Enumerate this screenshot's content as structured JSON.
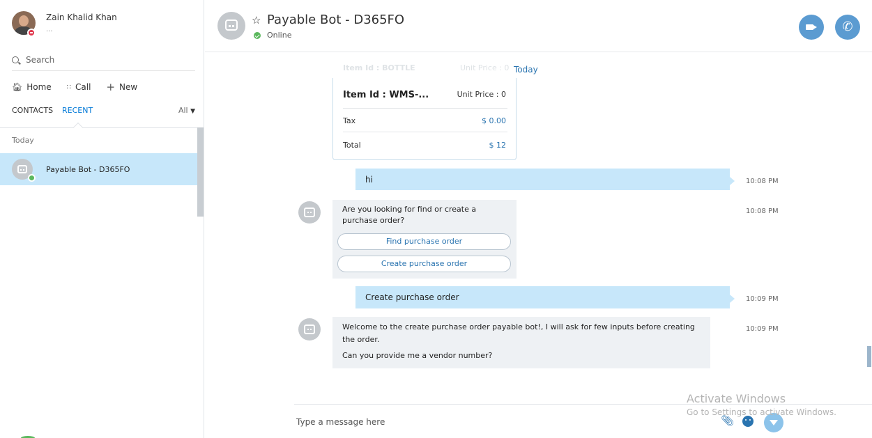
{
  "profile": {
    "name": "Zain Khalid Khan",
    "mood": "..."
  },
  "search": {
    "placeholder": "Search"
  },
  "nav": {
    "home": "Home",
    "call": "Call",
    "new": "New"
  },
  "tabs": {
    "contacts": "CONTACTS",
    "recent": "RECENT",
    "filter": "All"
  },
  "recent": {
    "group": "Today",
    "contact_name": "Payable Bot - D365FO"
  },
  "header": {
    "title": "Payable Bot - D365FO",
    "status": "Online"
  },
  "chat": {
    "faded_item": "Item Id : BOTTLE",
    "faded_price": "Unit Price : 0",
    "date_label": "Today",
    "receipt": {
      "item": "Item Id : WMS-...",
      "unit_price": "Unit Price : 0",
      "tax_label": "Tax",
      "tax_value": "$ 0.00",
      "total_label": "Total",
      "total_value": "$ 12"
    },
    "messages": [
      {
        "from": "me",
        "text": "hi",
        "time": "10:08 PM"
      },
      {
        "from": "bot",
        "text": "Are you looking for find or create a purchase order?",
        "time": "10:08 PM",
        "actions": [
          "Find purchase order",
          "Create purchase order"
        ]
      },
      {
        "from": "me",
        "text": "Create purchase order",
        "time": "10:09 PM"
      },
      {
        "from": "bot",
        "text": "Welcome to the create purchase order payable bot!, I will ask for few inputs before creating the order.",
        "text2": "Can you provide me a vendor number?",
        "time": "10:09 PM"
      }
    ]
  },
  "composer": {
    "placeholder": "Type a message here"
  },
  "watermark": {
    "title": "Activate Windows",
    "subtitle": "Go to Settings to activate Windows."
  },
  "colors": {
    "accent": "#0078d7",
    "link": "#2a74b0",
    "selected": "#c7e7fa",
    "online": "#5bb85d",
    "call_button": "#5b9bd1"
  },
  "icons": [
    "search-icon",
    "home-icon",
    "dialpad-icon",
    "plus-icon",
    "chevron-down-icon",
    "star-icon",
    "video-call-icon",
    "phone-icon",
    "attach-icon",
    "emoji-icon",
    "send-icon"
  ]
}
